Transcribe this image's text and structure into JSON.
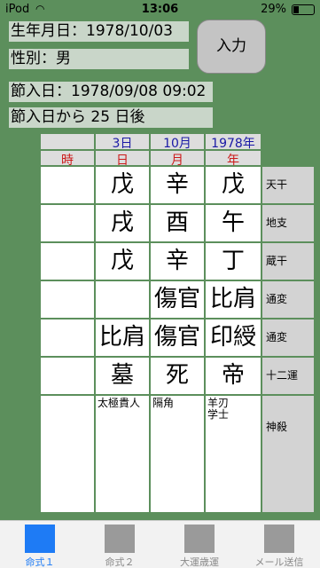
{
  "status": {
    "carrier": "iPod",
    "time": "13:06",
    "battery": "29%",
    "battery_level": 0.29
  },
  "info": {
    "birthdate": "生年月日：1978/10/03",
    "gender": "性別：男",
    "setsuiri": "節入日：1978/09/08 09:02",
    "days_after": "節入日から 25 日後"
  },
  "input_button": "入力",
  "headers": {
    "day": "3日",
    "month": "10月",
    "year": "1978年"
  },
  "pillars": {
    "hour": "時",
    "day": "日",
    "month": "月",
    "year": "年"
  },
  "rows": [
    {
      "label": "天干",
      "hour": "",
      "day": "戊",
      "month": "辛",
      "year": "戊"
    },
    {
      "label": "地支",
      "hour": "",
      "day": "戌",
      "month": "酉",
      "year": "午"
    },
    {
      "label": "蔵干",
      "hour": "",
      "day": "戊",
      "month": "辛",
      "year": "丁"
    },
    {
      "label": "通変",
      "hour": "",
      "day": "",
      "month": "傷官",
      "year": "比肩"
    },
    {
      "label": "通変",
      "hour": "",
      "day": "比肩",
      "month": "傷官",
      "year": "印綬"
    },
    {
      "label": "十二運",
      "hour": "",
      "day": "墓",
      "month": "死",
      "year": "帝"
    }
  ],
  "shinsatsu": {
    "label": "神殺",
    "hour": "",
    "day": "太極貴人",
    "month": "隔角",
    "year": "羊刃\n学士"
  },
  "tabs": [
    {
      "label": "命式１",
      "icon": "square-icon",
      "active": true
    },
    {
      "label": "命式２",
      "icon": "square-icon",
      "active": false
    },
    {
      "label": "大運歳運",
      "icon": "square-icon",
      "active": false
    },
    {
      "label": "メール送信",
      "icon": "square-icon",
      "active": false
    }
  ]
}
